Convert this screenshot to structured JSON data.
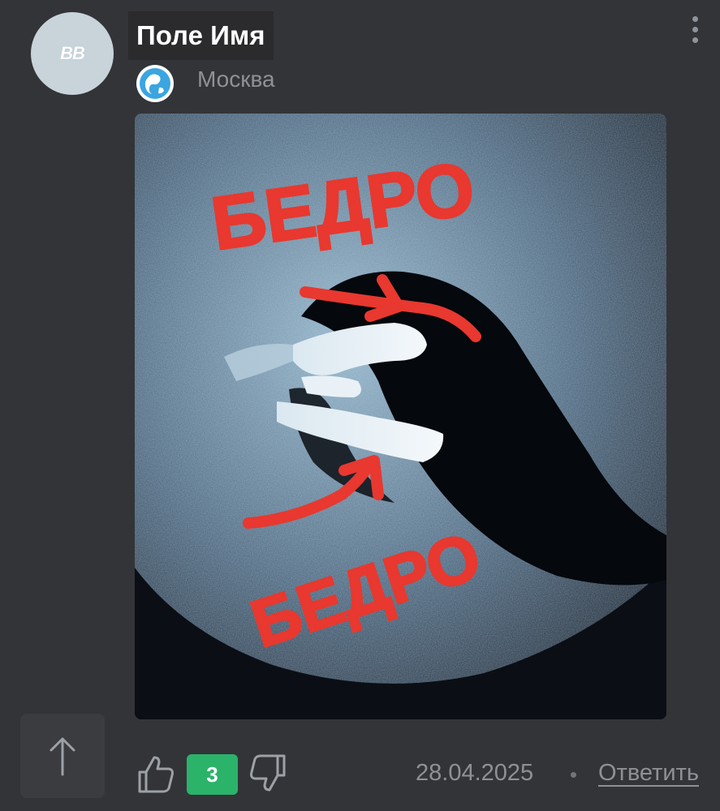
{
  "comment": {
    "avatar_initials": "BB",
    "author_name": "Поле Имя",
    "city": "Москва",
    "badge_icon": "globe-badge-icon",
    "menu_icon": "more-vertical-icon",
    "image": {
      "annotation_top": "БЕДРО",
      "annotation_bottom": "БЕДРО",
      "annotation_color": "#e8382f"
    },
    "footer": {
      "like_icon": "thumbs-up-icon",
      "vote_count": "3",
      "vote_color": "#2bb36a",
      "dislike_icon": "thumbs-down-icon",
      "date": "28.04.2025",
      "reply_label": "Ответить"
    }
  },
  "scroll_up_icon": "arrow-up-icon"
}
